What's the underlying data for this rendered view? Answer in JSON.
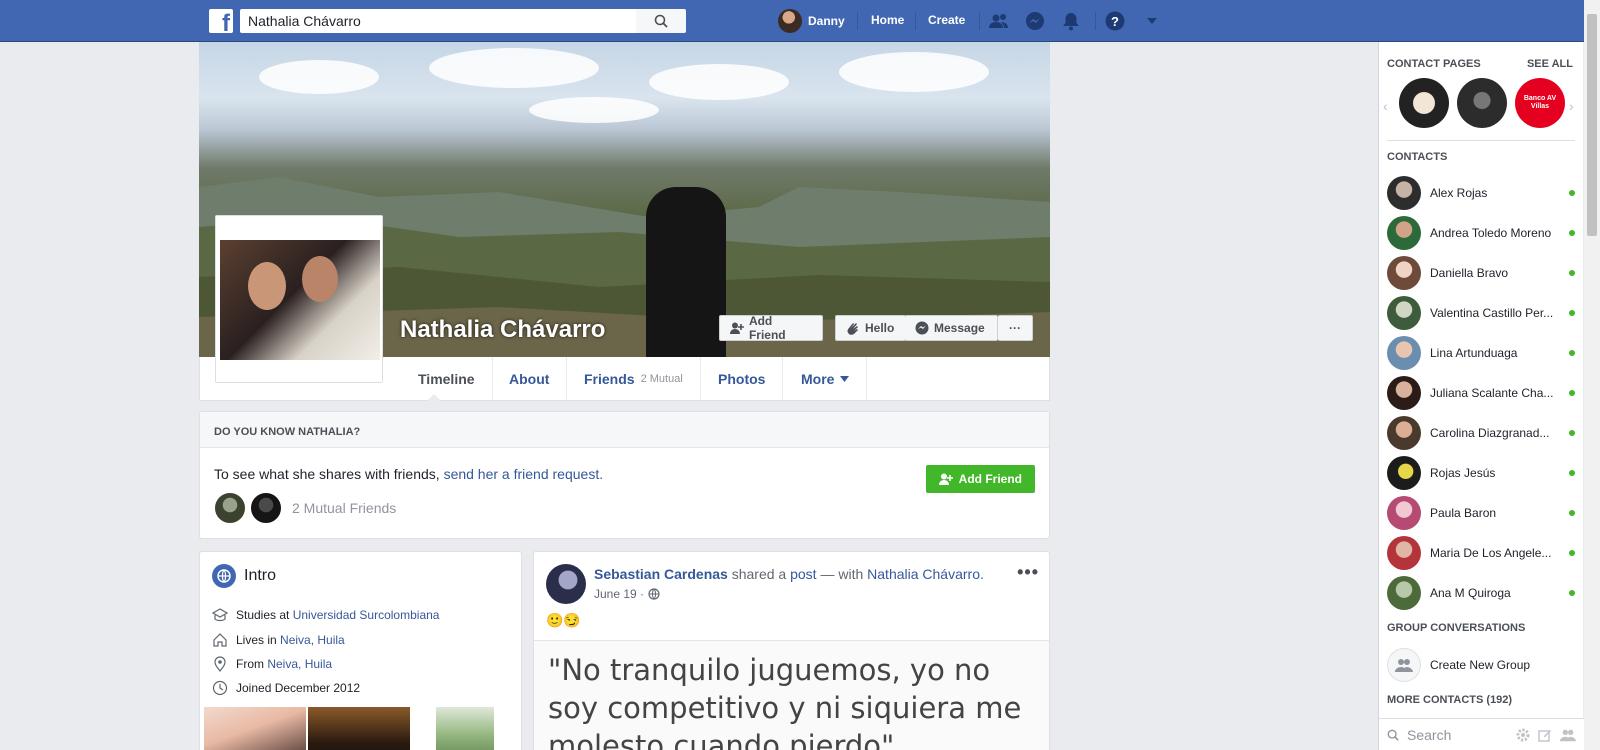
{
  "header": {
    "search_value": "Nathalia Chávarro",
    "user_name": "Danny",
    "nav_home": "Home",
    "nav_create": "Create"
  },
  "profile": {
    "name": "Nathalia Chávarro",
    "add_friend_label": "Add Friend",
    "hello_label": "Hello",
    "message_label": "Message",
    "more_dots": "···"
  },
  "tabs": [
    {
      "label": "Timeline"
    },
    {
      "label": "About"
    },
    {
      "label": "Friends",
      "sub": "2 Mutual"
    },
    {
      "label": "Photos"
    },
    {
      "label": "More"
    }
  ],
  "know_card": {
    "heading": "DO YOU KNOW NATHALIA?",
    "text_prefix": "To see what she shares with friends,",
    "link_text": "send her a friend request.",
    "mutual_text": "2 Mutual Friends",
    "button_label": "Add Friend"
  },
  "intro": {
    "title": "Intro",
    "studies_prefix": "Studies at",
    "studies_link": "Universidad Surcolombiana",
    "lives_prefix": "Lives in",
    "lives_link": "Neiva, Huila",
    "from_prefix": "From",
    "from_link": "Neiva, Huila",
    "joined": "Joined December 2012"
  },
  "post": {
    "author": "Sebastian Cardenas",
    "shared": "shared a",
    "post_link": "post",
    "with": "— with",
    "tagged": "Nathalia Chávarro.",
    "date": "June 19 ·",
    "emoji": "🙂😏",
    "quote": "\"No tranquilo juguemos, yo no soy competitivo y ni siquiera me molesto cuando pierdo\"",
    "menu_dots": "•••"
  },
  "sidebar": {
    "contact_pages_heading": "CONTACT PAGES",
    "see_all": "SEE ALL",
    "contacts_heading": "CONTACTS",
    "contacts": [
      {
        "name": "Alex Rojas"
      },
      {
        "name": "Andrea Toledo Moreno"
      },
      {
        "name": "Daniella Bravo"
      },
      {
        "name": "Valentina Castillo Per..."
      },
      {
        "name": "Lina Artunduaga"
      },
      {
        "name": "Juliana Scalante Cha..."
      },
      {
        "name": "Carolina Diazgranad..."
      },
      {
        "name": "Rojas Jesús"
      },
      {
        "name": "Paula Baron"
      },
      {
        "name": "Maria De Los Angele..."
      },
      {
        "name": "Ana M Quiroga"
      }
    ],
    "group_heading": "GROUP CONVERSATIONS",
    "create_group": "Create New Group",
    "more_contacts": "MORE CONTACTS (192)",
    "search_placeholder": "Search",
    "page_badge_text": "Banco AV Villas"
  },
  "colors": {
    "brand": "#4267b2",
    "link": "#365899",
    "green": "#42b72a",
    "background": "#e9ebee"
  }
}
